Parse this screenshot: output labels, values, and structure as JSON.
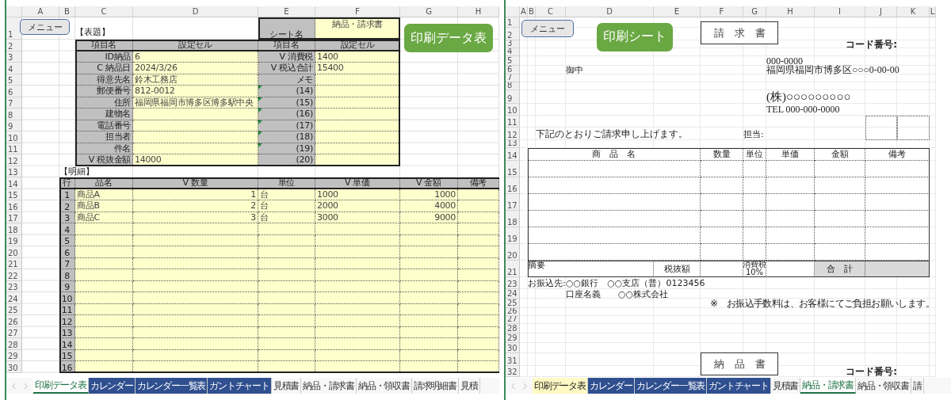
{
  "left_sheet": {
    "column_headers": [
      "A",
      "B",
      "C",
      "D",
      "E",
      "F",
      "G",
      "H"
    ],
    "row_headers": [
      "1",
      "2",
      "3",
      "4",
      "5",
      "6",
      "7",
      "8",
      "9",
      "10",
      "11",
      "12",
      "13",
      "14",
      "15",
      "16",
      "17",
      "18",
      "19",
      "20",
      "21",
      "22",
      "23",
      "24",
      "25",
      "26",
      "27",
      "28",
      "29",
      "30"
    ],
    "menu_button": "メニュー",
    "title_label": "【表題】",
    "sheet_name_label": "シート名",
    "sheet_name": "納品・請求書",
    "badge": "印刷データ表",
    "settings_table": {
      "columns": [
        "項目名",
        "設定セル",
        "項目名",
        "設定セル"
      ],
      "rows": [
        {
          "label_1": "ID納品",
          "value_1": "6",
          "label_2": "V 消費税",
          "value_2": "1400",
          "flagged": false
        },
        {
          "label_1": "C 納品日",
          "value_1": "2024/3/26",
          "label_2": "V 税込合計",
          "value_2": "15400",
          "flagged": false
        },
        {
          "label_1": "得意先名",
          "value_1": "鈴木工務店",
          "label_2": "メモ",
          "flagged": false
        },
        {
          "label_1": "郵便番号",
          "value_1": "812-0012",
          "label_2": "(14)",
          "flagged": true
        },
        {
          "label_1": "住所",
          "value_1": "福岡県福岡市博多区博多駅中央",
          "label_2": "(15)",
          "flagged": true
        },
        {
          "label_1": "建物名",
          "label_2": "(16)",
          "flagged": true
        },
        {
          "label_1": "電話番号",
          "label_2": "(17)",
          "flagged": true
        },
        {
          "label_1": "担当者",
          "label_2": "(18)",
          "flagged": true
        },
        {
          "label_1": "件名",
          "label_2": "(19)",
          "flagged": true
        },
        {
          "label_1": "V 税抜金額",
          "value_1": "14000",
          "label_2": "(20)",
          "flagged": false
        }
      ]
    },
    "detail_label": "【明細】",
    "detail_table": {
      "columns": [
        "行",
        "品名",
        "V 数量",
        "単位",
        "V 単価",
        "V 金額",
        "備考"
      ],
      "rows": [
        {
          "no": "1",
          "name": "商品A",
          "quantity": "1",
          "unit": "台",
          "unit_price": "1000",
          "amount": "1000"
        },
        {
          "no": "2",
          "name": "商品B",
          "quantity": "2",
          "unit": "台",
          "unit_price": "2000",
          "amount": "4000"
        },
        {
          "no": "3",
          "name": "商品C",
          "quantity": "3",
          "unit": "台",
          "unit_price": "3000",
          "amount": "9000"
        },
        {
          "no": "4"
        },
        {
          "no": "5"
        },
        {
          "no": "6"
        },
        {
          "no": "7"
        },
        {
          "no": "8"
        },
        {
          "no": "9"
        },
        {
          "no": "10"
        },
        {
          "no": "11"
        },
        {
          "no": "12"
        },
        {
          "no": "13"
        },
        {
          "no": "14"
        },
        {
          "no": "15"
        },
        {
          "no": "16"
        }
      ]
    },
    "tabs": [
      {
        "label": "印刷データ表",
        "selected": true
      },
      {
        "label": "カレンダー",
        "selected": false,
        "color": "#2f4f8f"
      },
      {
        "label": "カレンダー一覧表",
        "selected": false,
        "color": "#2f4f8f"
      },
      {
        "label": "ガントチャート",
        "selected": false,
        "color": "#2f4f8f"
      },
      {
        "label": "見積書",
        "selected": false
      },
      {
        "label": "納品・請求書",
        "selected": false
      },
      {
        "label": "納品・領収書",
        "selected": false
      },
      {
        "label": "請求明細書",
        "selected": false
      },
      {
        "label": "見積",
        "selected": false
      }
    ]
  },
  "right_sheet": {
    "column_headers": [
      "A",
      "B",
      "C",
      "D",
      "E",
      "F",
      "G",
      "H",
      "I",
      "J",
      "K",
      "L"
    ],
    "row_headers": [
      "1",
      "2",
      "3",
      "4",
      "5",
      "6",
      "7",
      "8",
      "9",
      "10",
      "11",
      "12",
      "13",
      "14",
      "15",
      "16",
      "17",
      "18",
      "19",
      "20",
      "21",
      "23",
      "24",
      "25",
      "26",
      "27",
      "28",
      "29",
      "30",
      "31",
      "32"
    ],
    "menu_button": "メニュー",
    "badge": "印刷シート",
    "doc_title": "請　求　書",
    "code_label": "コード番号:",
    "postal_code": "000-0000",
    "address": "福岡県福岡市博多区○○○0-00-00",
    "honorific": "御中",
    "company": "(株)○○○○○○○○○",
    "tel": "TEL 000-000-0000",
    "greeting": "下記のとおりご請求申し上げます。",
    "person_label": "担当:",
    "invoice_table": {
      "columns": [
        "商　品　名",
        "数量",
        "単位",
        "単価",
        "金額",
        "備考"
      ],
      "summary_label": "摘要",
      "subtotal_label": "税抜額",
      "tax_label": "消費税",
      "tax_rate": "10%",
      "total_label": "合　計"
    },
    "bank_label": "お振込先:",
    "bank_account": "○○銀行　○○支店（普）0123456",
    "account_holder": "口座名義　　○○株式会社",
    "fee_note": "※　お振込手数料は、お客様にてご負担お願いします。",
    "second_title": "納　品　書",
    "second_code_label": "コード番号:",
    "tabs": [
      {
        "label": "印刷データ表",
        "selected": false,
        "color": "#fff9c4"
      },
      {
        "label": "カレンダー",
        "selected": false,
        "color": "#2f4f8f"
      },
      {
        "label": "カレンダー一覧表",
        "selected": false,
        "color": "#2f4f8f"
      },
      {
        "label": "ガントチャート",
        "selected": false,
        "color": "#2f4f8f"
      },
      {
        "label": "見積書",
        "selected": false
      },
      {
        "label": "納品・請求書",
        "selected": true
      },
      {
        "label": "納品・領収書",
        "selected": false
      },
      {
        "label": "請",
        "selected": false
      }
    ]
  }
}
